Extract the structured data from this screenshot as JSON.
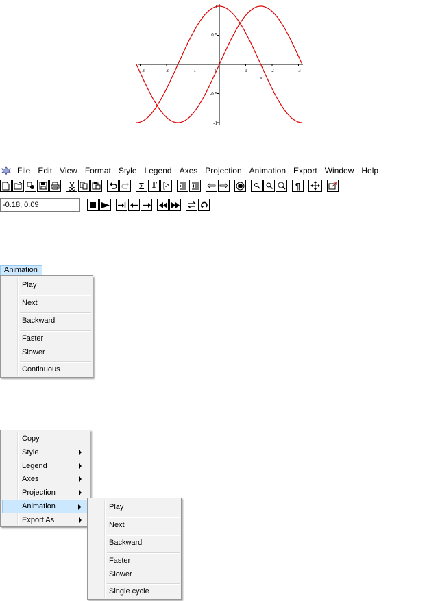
{
  "plot": {
    "x_ticks": [
      "-3",
      "-2",
      "-1",
      "0",
      "1",
      "2",
      "3"
    ],
    "y_ticks": [
      "1",
      "0.5",
      "-0.5",
      "-1"
    ],
    "x_label": "x",
    "curve_color": "#e00000"
  },
  "menubar": {
    "items": [
      "File",
      "Edit",
      "View",
      "Format",
      "Style",
      "Legend",
      "Axes",
      "Projection",
      "Animation",
      "Export",
      "Window",
      "Help"
    ]
  },
  "coord_field": {
    "value": "-0.18, 0.09"
  },
  "animation_menu": {
    "title": "Animation",
    "items": [
      "Play",
      "Next",
      "Backward",
      "Faster",
      "Slower",
      "Continuous"
    ]
  },
  "context_menu": {
    "items": [
      "Copy",
      "Style",
      "Legend",
      "Axes",
      "Projection",
      "Animation",
      "Export As"
    ],
    "highlighted": "Animation"
  },
  "submenu": {
    "items": [
      "Play",
      "Next",
      "Backward",
      "Faster",
      "Slower",
      "Single cycle"
    ]
  }
}
